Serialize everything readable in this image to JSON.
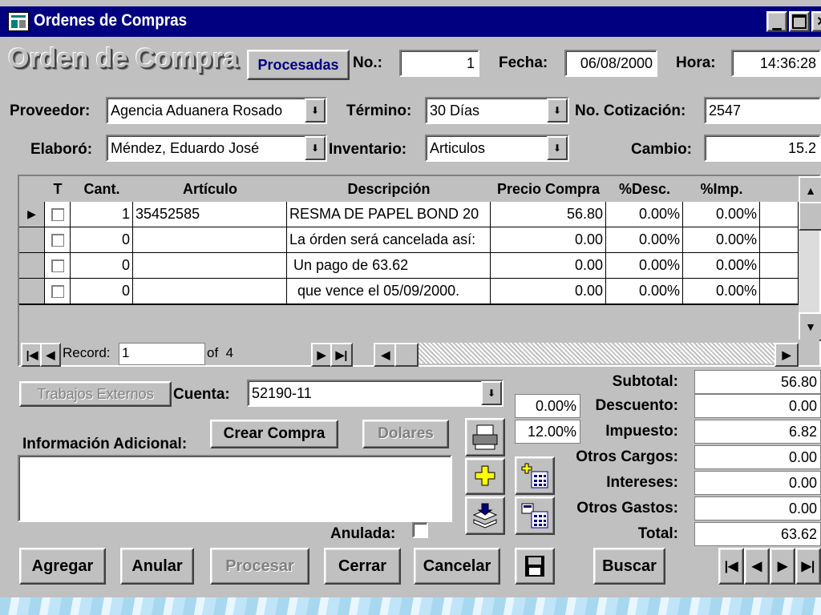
{
  "window": {
    "title": "Ordenes de Compras"
  },
  "header": {
    "form_title": "Orden de Compra",
    "status_button": "Procesadas",
    "no_label": "No.:",
    "no_value": "1",
    "fecha_label": "Fecha:",
    "fecha_value": "06/08/2000",
    "hora_label": "Hora:",
    "hora_value": "14:36:28"
  },
  "fields": {
    "proveedor_label": "Proveedor:",
    "proveedor_value": "Agencia Aduanera Rosado",
    "termino_label": "Término:",
    "termino_value": "30 Días",
    "cotizacion_label": "No. Cotización:",
    "cotizacion_value": "2547",
    "elaboro_label": "Elaboró:",
    "elaboro_value": "Méndez, Eduardo José",
    "inventario_label": "Inventario:",
    "inventario_value": "Articulos",
    "cambio_label": "Cambio:",
    "cambio_value": "15.2"
  },
  "grid": {
    "columns": [
      "T",
      "Cant.",
      "Artículo",
      "Descripción",
      "Precio Compra",
      "%Desc.",
      "%Imp."
    ],
    "rows": [
      {
        "cant": "1",
        "articulo": "35452585",
        "descripcion": "RESMA DE PAPEL BOND 20",
        "precio": "56.80",
        "desc": "0.00%",
        "imp": "0.00%"
      },
      {
        "cant": "0",
        "articulo": "",
        "descripcion": "La órden será cancelada así:",
        "precio": "0.00",
        "desc": "0.00%",
        "imp": "0.00%"
      },
      {
        "cant": "0",
        "articulo": "",
        "descripcion": " Un pago de 63.62",
        "precio": "0.00",
        "desc": "0.00%",
        "imp": "0.00%"
      },
      {
        "cant": "0",
        "articulo": "",
        "descripcion": "  que vence el 05/09/2000.",
        "precio": "0.00",
        "desc": "0.00%",
        "imp": "0.00%"
      }
    ],
    "record_label": "Record:",
    "record_value": "1",
    "of_label": "of  4"
  },
  "lower": {
    "trabajos_button": "Trabajos Externos",
    "cuenta_label": "Cuenta:",
    "cuenta_value": "52190-11",
    "info_label": "Información Adicional:",
    "crear_button": "Crear Compra",
    "dolares_button": "Dolares",
    "anulada_label": "Anulada:",
    "descuento_pct": "0.00%",
    "impuesto_pct": "12.00%"
  },
  "totals": [
    {
      "label": "Subtotal:",
      "value": "56.80"
    },
    {
      "label": "Descuento:",
      "value": "0.00"
    },
    {
      "label": "Impuesto:",
      "value": "6.82"
    },
    {
      "label": "Otros Cargos:",
      "value": "0.00"
    },
    {
      "label": "Intereses:",
      "value": "0.00"
    },
    {
      "label": "Otros Gastos:",
      "value": "0.00"
    },
    {
      "label": "Total:",
      "value": "63.62"
    }
  ],
  "toolbar": {
    "agregar": "Agregar",
    "anular": "Anular",
    "procesar": "Procesar",
    "cerrar": "Cerrar",
    "cancelar": "Cancelar",
    "buscar": "Buscar"
  },
  "colors": {
    "titlebar": "#000080",
    "face": "#c0c0c0",
    "text_dim": "#808080"
  }
}
